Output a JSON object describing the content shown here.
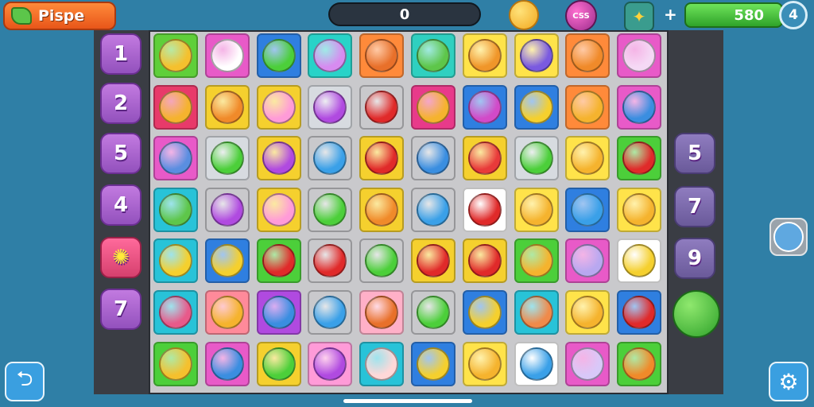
{
  "header": {
    "title": "Pispe",
    "score": "0",
    "bomb_label": "CSS",
    "energy_value": "580",
    "menu_label": "4"
  },
  "left_column": [
    "1",
    "2",
    "5",
    "4",
    "",
    "7"
  ],
  "right_column": [
    "5",
    "7",
    "9"
  ],
  "icons": {
    "leaf": "leaf-icon",
    "coin": "coin-icon",
    "bomb": "bomb-icon",
    "rocket": "rocket-icon",
    "back": "back-arrow-icon",
    "settings": "gear-icon",
    "bug": "bug-icon"
  },
  "board": {
    "rows": [
      [
        [
          "#5fcf3a",
          "#f5c02e",
          ""
        ],
        [
          "#e85ac8",
          "#ffffff",
          ""
        ],
        [
          "#2f7fe0",
          "#4ccf3a",
          ""
        ],
        [
          "#28d3c8",
          "#d78bf0",
          ""
        ],
        [
          "#ff8a3a",
          "#e8702a",
          ""
        ],
        [
          "#2fd0c0",
          "#5ec64a",
          ""
        ],
        [
          "#ffe34a",
          "#f0962a",
          ""
        ],
        [
          "#ffe34a",
          "#7a5ae0",
          ""
        ],
        [
          "#ff8a3a",
          "#f08a2a",
          ""
        ],
        [
          "#e85ac8",
          "#f5d9f5",
          ""
        ]
      ],
      [
        [
          "#e83a6a",
          "#f5b32e",
          ""
        ],
        [
          "#f5d02e",
          "#f08a2a",
          ""
        ],
        [
          "#f5d02e",
          "#ff9bd8",
          ""
        ],
        [
          "#d7dbe0",
          "#b04ae0",
          ""
        ],
        [
          "#c9c9cc",
          "#e02a2a",
          ""
        ],
        [
          "#e83a8a",
          "#f5b32e",
          ""
        ],
        [
          "#2f7fe0",
          "#d24ac8",
          ""
        ],
        [
          "#2f7fe0",
          "#f5d02e",
          ""
        ],
        [
          "#ff8a3a",
          "#f5b32e",
          ""
        ],
        [
          "#e85ac8",
          "#3a8ee0",
          ""
        ]
      ],
      [
        [
          "#e85ac8",
          "#5a8ee0",
          ""
        ],
        [
          "#d7dbe0",
          "#4ccf3a",
          ""
        ],
        [
          "#f5d02e",
          "#b04ae0",
          ""
        ],
        [
          "#c9c9cc",
          "#3aa0e8",
          ""
        ],
        [
          "#f5d02e",
          "#e02a2a",
          ""
        ],
        [
          "#c9c9cc",
          "#3a8ee0",
          ""
        ],
        [
          "#f5d02e",
          "#e83a3a",
          ""
        ],
        [
          "#d7dbe0",
          "#4ccf3a",
          ""
        ],
        [
          "#ffe34a",
          "#f5b32e",
          ""
        ],
        [
          "#4ccf3a",
          "#e02a2a",
          ""
        ]
      ],
      [
        [
          "#28c3d8",
          "#5ec64a",
          ""
        ],
        [
          "#c9c9cc",
          "#b04ae0",
          ""
        ],
        [
          "#f5d02e",
          "#ff9bd8",
          ""
        ],
        [
          "#c9c9cc",
          "#4ccf3a",
          ""
        ],
        [
          "#f5d02e",
          "#f08a2a",
          ""
        ],
        [
          "#c9c9cc",
          "#3aa0e8",
          ""
        ],
        [
          "#ffffff",
          "#e02a2a",
          ""
        ],
        [
          "#ffe34a",
          "#f5b32e",
          ""
        ],
        [
          "#2f7fe0",
          "#3aa0e8",
          ""
        ],
        [
          "#ffe34a",
          "#f5b32e",
          ""
        ]
      ],
      [
        [
          "#28c3d8",
          "#f5d02e",
          ""
        ],
        [
          "#2f7fe0",
          "#f5d02e",
          ""
        ],
        [
          "#4ccf3a",
          "#e02a2a",
          ""
        ],
        [
          "#c9c9cc",
          "#e02a2a",
          ""
        ],
        [
          "#c9c9cc",
          "#4ccf3a",
          ""
        ],
        [
          "#f5d02e",
          "#e02a2a",
          ""
        ],
        [
          "#f5d02e",
          "#e02a2a",
          ""
        ],
        [
          "#4ccf3a",
          "#f5b32e",
          ""
        ],
        [
          "#e85ac8",
          "#b8a8f0",
          ""
        ],
        [
          "#ffffff",
          "#f5d02e",
          ""
        ]
      ],
      [
        [
          "#28c3d8",
          "#e85a8a",
          ""
        ],
        [
          "#ff8a9a",
          "#f5b32e",
          ""
        ],
        [
          "#b04ae0",
          "#3a8ee0",
          ""
        ],
        [
          "#c9c9cc",
          "#3aa0e8",
          ""
        ],
        [
          "#ffb0c8",
          "#e8702a",
          ""
        ],
        [
          "#c9c9cc",
          "#4ccf3a",
          ""
        ],
        [
          "#2f7fe0",
          "#f5d02e",
          ""
        ],
        [
          "#28c3d8",
          "#f08a4a",
          ""
        ],
        [
          "#ffe34a",
          "#f5b32e",
          ""
        ],
        [
          "#2f7fe0",
          "#e02a2a",
          ""
        ]
      ],
      [
        [
          "#4ccf3a",
          "#f5c02e",
          ""
        ],
        [
          "#e85ac8",
          "#3a8ee0",
          ""
        ],
        [
          "#f5d02e",
          "#4ccf3a",
          ""
        ],
        [
          "#ff9bd8",
          "#b04ae0",
          ""
        ],
        [
          "#28c3d8",
          "#ffd8d8",
          ""
        ],
        [
          "#2f7fe0",
          "#f5d02e",
          ""
        ],
        [
          "#ffe34a",
          "#f5b32e",
          ""
        ],
        [
          "#ffffff",
          "#3aa0e8",
          ""
        ],
        [
          "#e85ac8",
          "#d8c8f8",
          ""
        ],
        [
          "#4ccf3a",
          "#f08a2a",
          ""
        ]
      ]
    ]
  }
}
